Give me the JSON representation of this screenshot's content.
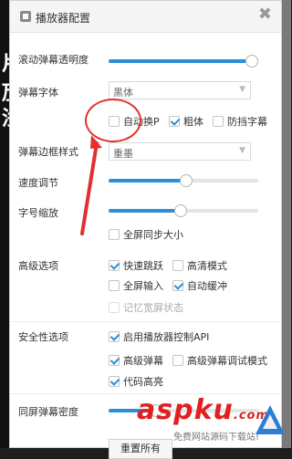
{
  "dialog": {
    "title": "播放器配置"
  },
  "background": {
    "glyphs": [
      "片",
      "劢",
      "浅"
    ]
  },
  "settings": {
    "opacity": {
      "label": "滚动弹幕透明度",
      "value": 1.0
    },
    "font": {
      "label": "弹幕字体",
      "selected": "黑体",
      "options": [
        {
          "label": "自动换P",
          "checked": false
        },
        {
          "label": "粗体",
          "checked": true
        },
        {
          "label": "防挡字幕",
          "checked": false
        }
      ]
    },
    "border": {
      "label": "弹幕边框样式",
      "selected": "重墨"
    },
    "speed": {
      "label": "速度调节",
      "value": 0.52
    },
    "size": {
      "label": "字号缩放",
      "value": 0.48,
      "fullscreen_sync": {
        "label": "全屏同步大小",
        "checked": false
      }
    },
    "advanced": {
      "label": "高级选项",
      "options": [
        {
          "label": "快速跳跃",
          "checked": true,
          "disabled": false
        },
        {
          "label": "高清模式",
          "checked": false,
          "disabled": false
        },
        {
          "label": "全屏输入",
          "checked": false,
          "disabled": false
        },
        {
          "label": "自动缓冲",
          "checked": true,
          "disabled": false
        },
        {
          "label": "记忆宽屏状态",
          "checked": false,
          "disabled": true
        }
      ]
    },
    "security": {
      "label": "安全性选项",
      "options": [
        {
          "label": "启用播放器控制API",
          "checked": true
        },
        {
          "label": "高级弹幕",
          "checked": true
        },
        {
          "label": "高级弹幕调试模式",
          "checked": false
        },
        {
          "label": "代码高亮",
          "checked": true
        }
      ]
    },
    "density": {
      "label": "同屏弹幕密度",
      "value": 0.3
    },
    "reset": {
      "label": "重置所有"
    }
  },
  "watermark": {
    "brand": "aspku",
    "domain_suffix": ".com",
    "subtitle": "免费网站源码下载站!"
  },
  "colors": {
    "accent": "#2a8fd6",
    "annotation": "#e23030"
  }
}
